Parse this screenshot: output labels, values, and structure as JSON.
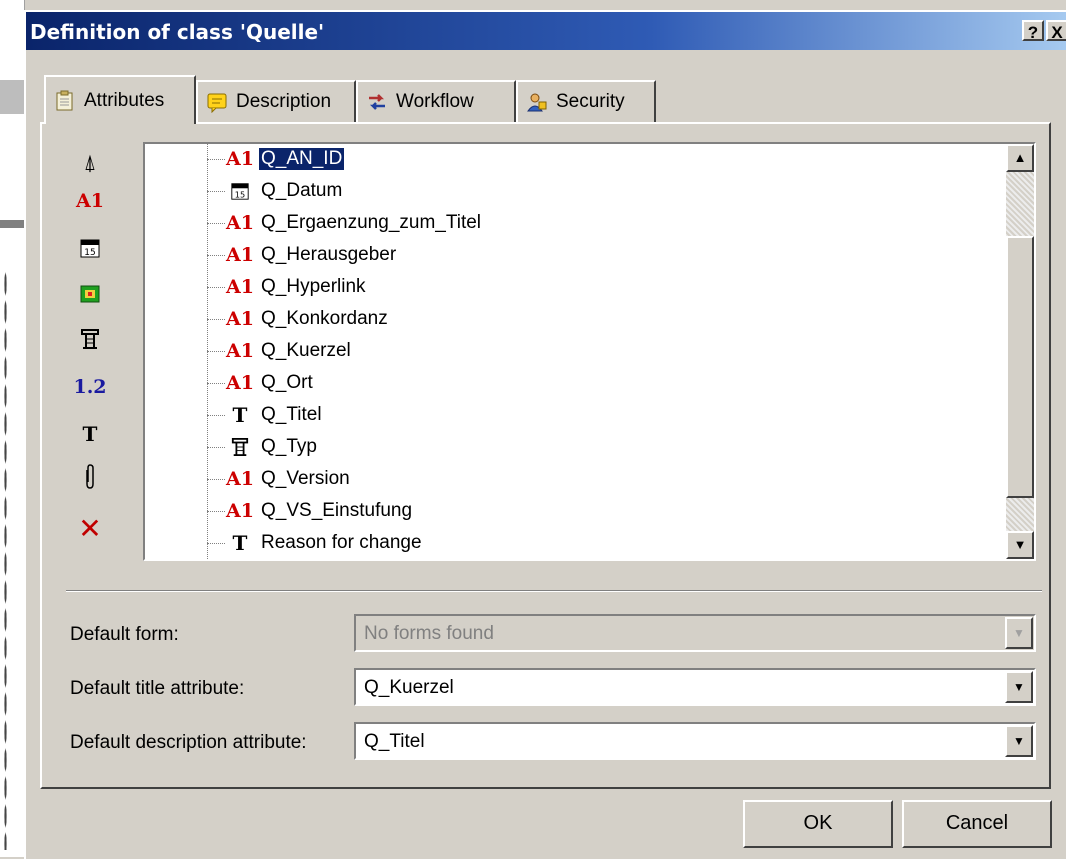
{
  "dialog": {
    "title": "Definition of class 'Quelle'",
    "help_label": "?",
    "close_label": "X"
  },
  "tabs": [
    {
      "label": "Attributes",
      "icon": "clipboard-icon"
    },
    {
      "label": "Description",
      "icon": "note-icon"
    },
    {
      "label": "Workflow",
      "icon": "workflow-icon"
    },
    {
      "label": "Security",
      "icon": "security-icon"
    }
  ],
  "toolbar": {
    "items": [
      {
        "name": "person-icon",
        "glyph": "⍋"
      },
      {
        "name": "text-attribute-icon",
        "glyph": "A1"
      },
      {
        "name": "date-attribute-icon",
        "glyph": "15"
      },
      {
        "name": "image-attribute-icon",
        "glyph": ""
      },
      {
        "name": "list-attribute-icon",
        "glyph": "目"
      },
      {
        "name": "number-attribute-icon",
        "glyph": "1.2"
      },
      {
        "name": "memo-attribute-icon",
        "glyph": "T"
      },
      {
        "name": "attachment-icon",
        "glyph": "🖇"
      },
      {
        "name": "delete-icon",
        "glyph": "✕"
      }
    ]
  },
  "attributes": [
    {
      "name": "Q_AN_ID",
      "type": "A1",
      "selected": true
    },
    {
      "name": "Q_Datum",
      "type": "date"
    },
    {
      "name": "Q_Ergaenzung_zum_Titel",
      "type": "A1"
    },
    {
      "name": "Q_Herausgeber",
      "type": "A1"
    },
    {
      "name": "Q_Hyperlink",
      "type": "A1"
    },
    {
      "name": "Q_Konkordanz",
      "type": "A1"
    },
    {
      "name": "Q_Kuerzel",
      "type": "A1"
    },
    {
      "name": "Q_Ort",
      "type": "A1"
    },
    {
      "name": "Q_Titel",
      "type": "T"
    },
    {
      "name": "Q_Typ",
      "type": "list"
    },
    {
      "name": "Q_Version",
      "type": "A1"
    },
    {
      "name": "Q_VS_Einstufung",
      "type": "A1"
    },
    {
      "name": "Reason for change",
      "type": "T"
    }
  ],
  "form": {
    "default_form_label": "Default form:",
    "default_form_value": "No forms found",
    "default_title_label": "Default title attribute:",
    "default_title_value": "Q_Kuerzel",
    "default_desc_label": "Default description attribute:",
    "default_desc_value": "Q_Titel"
  },
  "buttons": {
    "ok": "OK",
    "cancel": "Cancel"
  },
  "colors": {
    "titlebar": "#0a246a",
    "selection": "#0a246a",
    "a1_red": "#cc0000",
    "number_blue": "#1a1aa0"
  }
}
